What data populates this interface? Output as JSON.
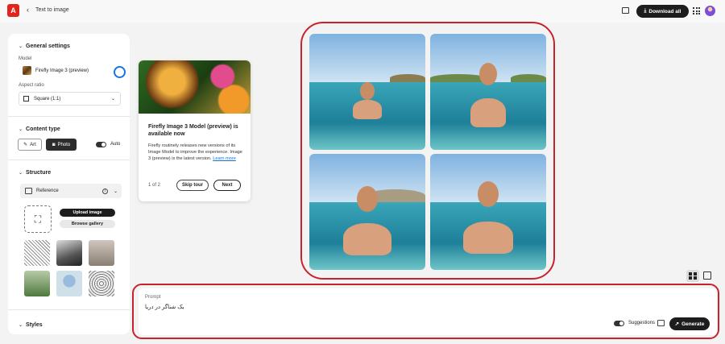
{
  "header": {
    "back_icon": "chevron-left-icon",
    "breadcrumb": "Text to image",
    "download_label": "Download all"
  },
  "sidebar": {
    "general_title": "General settings",
    "model_label": "Model",
    "model_value": "Firefly Image 3 (preview)",
    "aspect_label": "Aspect ratio",
    "aspect_value": "Square (1:1)",
    "content_title": "Content type",
    "content_art": "Art",
    "content_photo": "Photo",
    "auto_label": "Auto",
    "structure_title": "Structure",
    "reference_label": "Reference",
    "upload_label": "Upload image",
    "browse_label": "Browse gallery",
    "styles_title": "Styles"
  },
  "tour": {
    "title": "Firefly Image 3 Model (preview) is available now",
    "body": "Firefly routinely releases new versions of its Image Model to improve the experience. Image 3 (preview) is the latest version.",
    "link": "Learn more",
    "count": "1 of 2",
    "skip": "Skip tour",
    "next": "Next"
  },
  "prompt": {
    "label": "Prompt",
    "text": "یک شناگر در دریا",
    "suggestions_label": "Suggestions",
    "generate_label": "Generate"
  },
  "colors": {
    "accent": "#1473e6",
    "highlight": "#c8232c",
    "brand": "#e1251b"
  }
}
